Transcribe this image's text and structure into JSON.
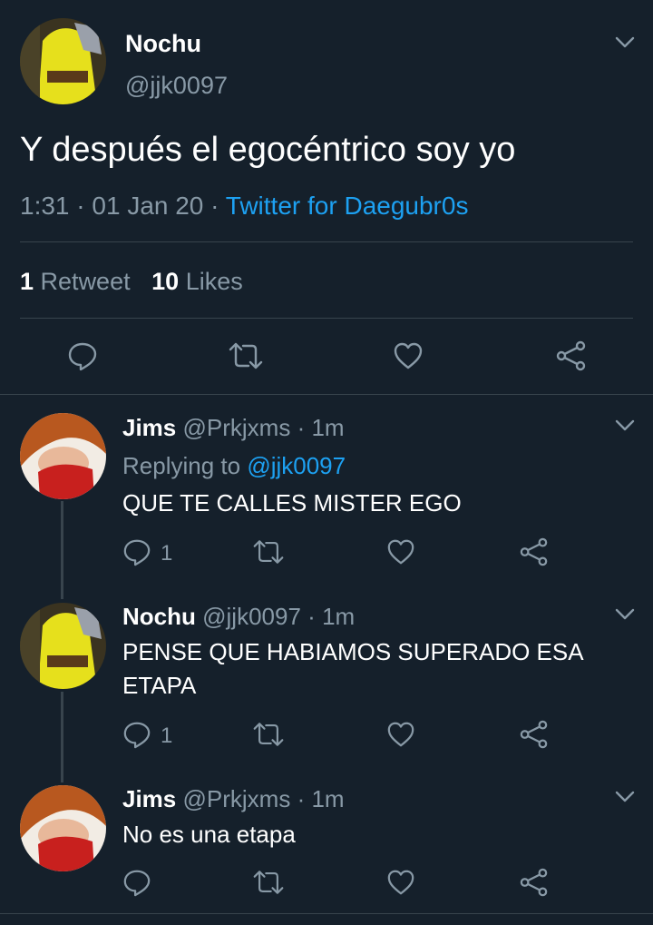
{
  "main_tweet": {
    "display_name": "Nochu",
    "handle": "@jjk0097",
    "text": "Y después el egocéntrico soy yo",
    "time": "1:31",
    "date": "01 Jan 20",
    "source": "Twitter for Daegubr0s",
    "retweets_count": "1",
    "retweets_label": "Retweet",
    "likes_count": "10",
    "likes_label": "Likes",
    "sep": "·"
  },
  "replies": [
    {
      "display_name": "Jims",
      "handle": "@Prkjxms",
      "time": "1m",
      "replying_to_label": "Replying to",
      "replying_to_handle": "@jjk0097",
      "text": "QUE TE CALLES MISTER EGO",
      "reply_count": "1"
    },
    {
      "display_name": "Nochu",
      "handle": "@jjk0097",
      "time": "1m",
      "text_line1": "PENSE QUE HABIAMOS SUPERADO ESA",
      "text_line2": "ETAPA",
      "reply_count": "1"
    },
    {
      "display_name": "Jims",
      "handle": "@Prkjxms",
      "time": "1m",
      "text": "No es una etapa"
    }
  ],
  "sep": "·",
  "icons": [
    "chevron-down-icon",
    "reply-icon",
    "retweet-icon",
    "like-icon",
    "share-icon"
  ],
  "colors": {
    "background": "#15202b",
    "muted": "#8899a6",
    "accent": "#1da1f2",
    "divider": "#38444d"
  }
}
